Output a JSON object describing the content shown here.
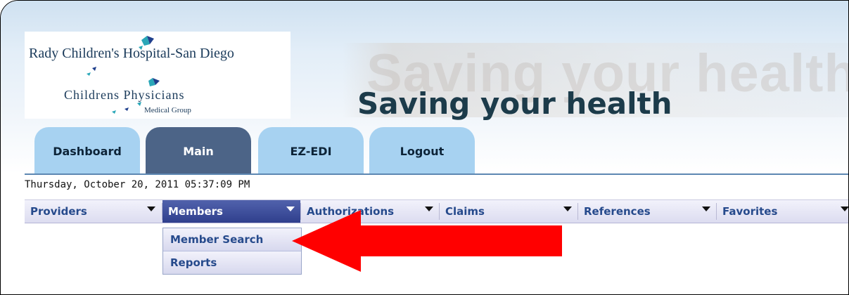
{
  "header": {
    "hospital_name": "Rady Children's Hospital-San Diego",
    "group_name": "Childrens Physicians",
    "group_sub": "Medical Group",
    "slogan": "Saving your health",
    "slogan_ghost": "Saving your health"
  },
  "tabs": [
    {
      "label": "Dashboard",
      "active": false
    },
    {
      "label": "Main",
      "active": true
    },
    {
      "label": "EZ-EDI",
      "active": false
    },
    {
      "label": "Logout",
      "active": false
    }
  ],
  "datetime": "Thursday, October 20, 2011 05:37:09 PM",
  "menu": [
    {
      "label": "Providers",
      "active": false
    },
    {
      "label": "Members",
      "active": true
    },
    {
      "label": "Authorizations",
      "active": false
    },
    {
      "label": "Claims",
      "active": false
    },
    {
      "label": "References",
      "active": false
    },
    {
      "label": "Favorites",
      "active": false
    }
  ],
  "members_dropdown": [
    {
      "label": "Member Search"
    },
    {
      "label": "Reports"
    }
  ],
  "colors": {
    "active_tab": "#4c6487",
    "inactive_tab": "#a7d2f1",
    "menu_active": "#3b4a9a",
    "menu_text": "#264a8c",
    "callout_arrow": "#ff0000"
  }
}
